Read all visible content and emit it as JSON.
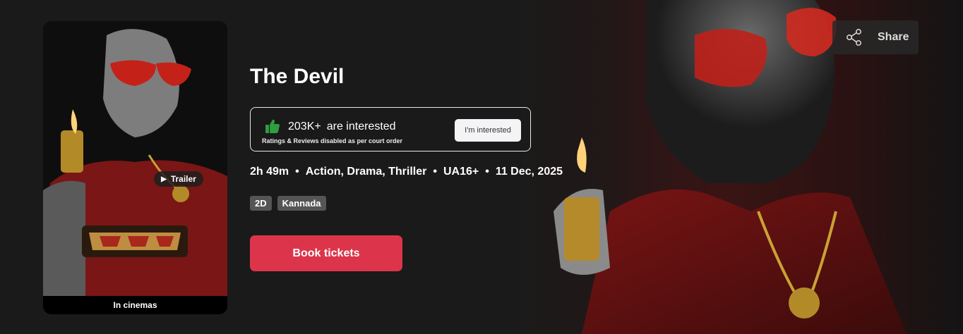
{
  "movie": {
    "title": "The Devil",
    "interest": {
      "count": "203K+",
      "text": "are interested",
      "disclaimer": "Ratings & Reviews disabled as per court order",
      "button_label": "I'm interested",
      "thumb_color": "#2e9e3f"
    },
    "meta": {
      "duration": "2h 49m",
      "genres": "Action, Drama, Thriller",
      "certificate": "UA16+",
      "release_date": "11 Dec, 2025"
    },
    "tags": [
      "2D",
      "Kannada"
    ],
    "book_label": "Book tickets",
    "accent_color": "#dc354b"
  },
  "poster": {
    "trailer_label": "Trailer",
    "status_label": "In cinemas"
  },
  "share": {
    "label": "Share"
  }
}
